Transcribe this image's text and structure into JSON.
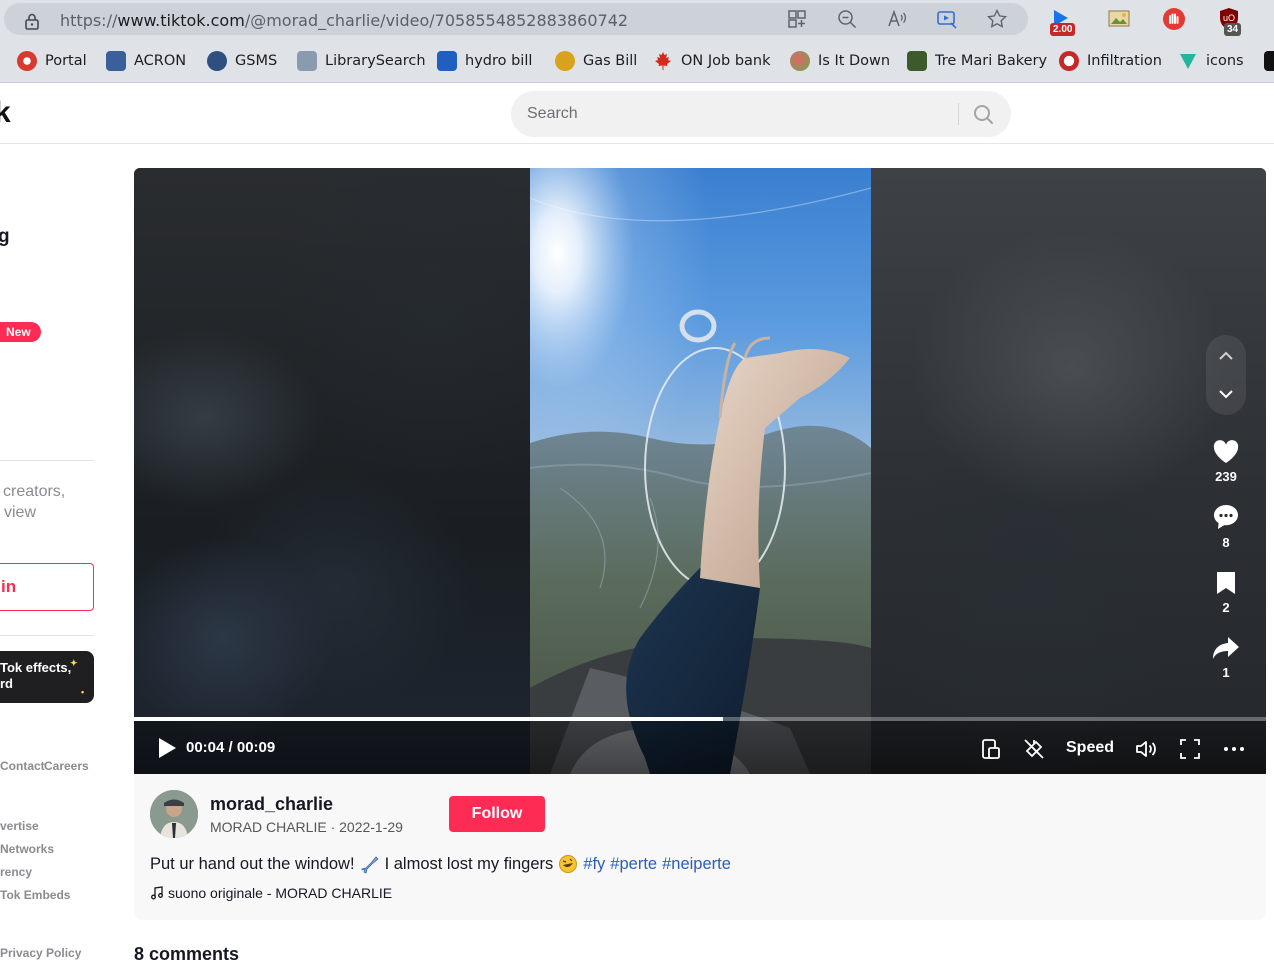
{
  "browser": {
    "url_prefix": "https://",
    "url_host": "www.tiktok.com",
    "url_path": "/@morad_charlie/video/7058554852883860742",
    "extensions": {
      "badge_1": "2.00",
      "badge_2": "34"
    },
    "bookmarks": [
      {
        "label": "Portal",
        "icon": "portal-icon",
        "color": "#d63b2f"
      },
      {
        "label": "ACRON",
        "icon": "acron-icon",
        "color": "#3b5f9a"
      },
      {
        "label": "GSMS",
        "icon": "gsms-icon",
        "color": "#2f4f7f"
      },
      {
        "label": "LibrarySearch",
        "icon": "library-icon",
        "color": "#8a9bb0"
      },
      {
        "label": "hydro bill",
        "icon": "hydro-icon",
        "color": "#1f5fbf"
      },
      {
        "label": "Gas Bill",
        "icon": "gas-icon",
        "color": "#d9a21b"
      },
      {
        "label": "ON Job bank",
        "icon": "maple-leaf-icon",
        "color": "#d52b1e"
      },
      {
        "label": "Is It Down",
        "icon": "isitdown-icon",
        "color": "#6aa84f"
      },
      {
        "label": "Tre Mari Bakery",
        "icon": "bakery-icon",
        "color": "#3d5a2a"
      },
      {
        "label": "Infiltration",
        "icon": "infiltration-icon",
        "color": "#c62828"
      },
      {
        "label": "icons",
        "icon": "icons-site-icon",
        "color": "#22b5a0"
      }
    ]
  },
  "header": {
    "logo_fragment": "k",
    "search_placeholder": "Search"
  },
  "sidebar": {
    "partial_item": "g",
    "new_badge": "New",
    "note_line_1": "creators,",
    "note_line_2": "view",
    "login_fragment": "in",
    "effects_line_1": "Tok effects,",
    "effects_line_2": "rd",
    "footer": {
      "contact": "Contact",
      "careers": "Careers",
      "advertise": "vertise",
      "networks": "Networks",
      "transparency": "rency",
      "embeds": "Tok Embeds",
      "privacy": "Privacy Policy"
    }
  },
  "player": {
    "current_time": "00:04",
    "duration": "00:09",
    "time_display": "00:04 / 00:09",
    "progress": 0.52,
    "speed_label": "Speed",
    "likes": "239",
    "comments": "8",
    "saves": "2",
    "shares": "1"
  },
  "post": {
    "username": "morad_charlie",
    "display_name": "MORAD CHARLIE",
    "date": "2022-1-29",
    "subline": "MORAD CHARLIE · 2022-1-29",
    "follow_label": "Follow",
    "caption_text_1": "Put ur hand out the window!",
    "caption_text_2": "I almost lost my fingers",
    "hashtags": [
      "#fy",
      "#perte",
      "#neiperte"
    ],
    "music": "suono originale - MORAD CHARLIE"
  },
  "comments": {
    "title": "8 comments"
  },
  "colors": {
    "brand": "#fe2c55",
    "hashtag": "#2b5db8"
  }
}
